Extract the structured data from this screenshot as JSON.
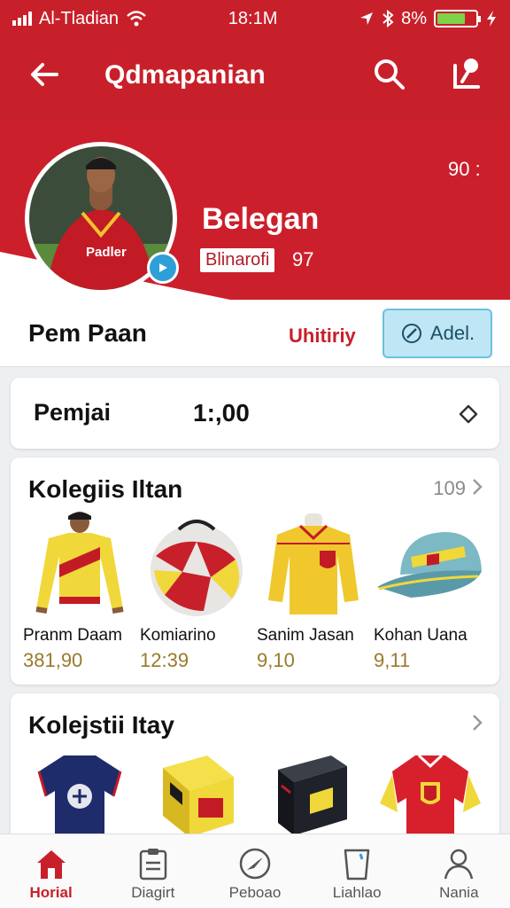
{
  "status_bar": {
    "carrier": "Al-Tladian",
    "time": "18:1M",
    "battery_text": "8%"
  },
  "app_bar": {
    "title": "Qdmapanian"
  },
  "profile": {
    "name": "Belegan",
    "tag": "Blinarofi",
    "tag_number": "97",
    "count": "90 :"
  },
  "name_row": {
    "player_name": "Pem Paan",
    "activity": "Uhitiriy",
    "add_button": "Adel."
  },
  "balance": {
    "label": "Pemjai",
    "value": "1:,00"
  },
  "collection_1": {
    "title": "Kolegiis Iltan",
    "count": "109",
    "items": [
      {
        "name": "Pranm Daam",
        "price": "381,90",
        "icon": "yellow-kit-player"
      },
      {
        "name": "Komiarino",
        "price": "12:39",
        "icon": "football"
      },
      {
        "name": "Sanim Jasan",
        "price": "9,10",
        "icon": "yellow-jersey"
      },
      {
        "name": "Kohan Uana",
        "price": "9,11",
        "icon": "cap"
      }
    ]
  },
  "collection_2": {
    "title": "Kolejstii Itay",
    "items": [
      {
        "icon": "navy-jersey"
      },
      {
        "icon": "yellow-box"
      },
      {
        "icon": "black-box"
      },
      {
        "icon": "red-jersey"
      }
    ]
  },
  "bottom_nav": [
    {
      "label": "Horial",
      "icon": "home-icon",
      "active": true
    },
    {
      "label": "Diagirt",
      "icon": "clipboard-icon",
      "active": false
    },
    {
      "label": "Peboao",
      "icon": "compass-icon",
      "active": false
    },
    {
      "label": "Liahlao",
      "icon": "cup-icon",
      "active": false
    },
    {
      "label": "Nania",
      "icon": "person-icon",
      "active": false
    }
  ],
  "colors": {
    "brand_red": "#c8202a",
    "accent_blue": "#2f9fd8",
    "price_gold": "#9a7a2a"
  }
}
